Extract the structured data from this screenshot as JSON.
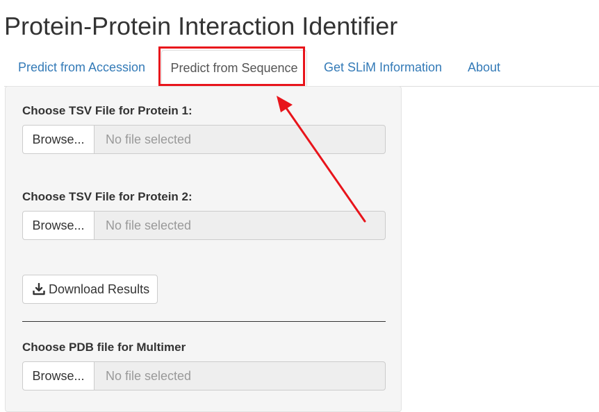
{
  "app": {
    "title": "Protein-Protein Interaction Identifier"
  },
  "tabs": [
    {
      "label": "Predict from Accession",
      "active": false
    },
    {
      "label": "Predict from Sequence",
      "active": true
    },
    {
      "label": "Get SLiM Information",
      "active": false
    },
    {
      "label": "About",
      "active": false
    }
  ],
  "panel": {
    "protein1": {
      "label": "Choose TSV File for Protein 1:",
      "browse_label": "Browse...",
      "placeholder": "No file selected"
    },
    "protein2": {
      "label": "Choose TSV File for Protein 2:",
      "browse_label": "Browse...",
      "placeholder": "No file selected"
    },
    "download": {
      "label": "Download Results",
      "icon": "download-icon"
    },
    "multimer": {
      "label": "Choose PDB file for Multimer",
      "browse_label": "Browse...",
      "placeholder": "No file selected"
    }
  },
  "colors": {
    "link": "#337ab7",
    "annotation": "#e8141b",
    "panel_bg": "#f5f5f5",
    "file_display_bg": "#eeeeee"
  }
}
